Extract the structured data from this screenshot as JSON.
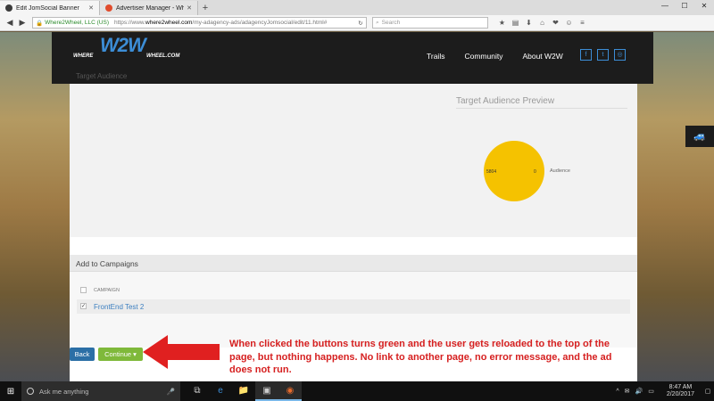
{
  "browser": {
    "tabs": [
      {
        "title": "Edit JomSocial Banner",
        "active": true,
        "favicon_color": "#3b3b3b"
      },
      {
        "title": "Advertiser Manager - Whe...",
        "active": false,
        "favicon_color": "#e04b2c"
      }
    ],
    "new_tab": "+",
    "window_controls": [
      "—",
      "☐",
      "✕"
    ],
    "nav": {
      "back": "◀",
      "forward": "▶",
      "home": "⌂"
    },
    "url": {
      "site_identity": "Where2Wheel, LLC (US)",
      "prefix": "https://www.",
      "domain": "where2wheel.com",
      "path": "/my-adagency-ads/adagencyJomsocial/edit/11.html#"
    },
    "reload": "↻",
    "search_placeholder": "Search",
    "toolbar_icons": [
      "★",
      "▤",
      "⬇",
      "⌂",
      "❤",
      "☺",
      "≡"
    ]
  },
  "site": {
    "logo": {
      "big": "W2W",
      "left_word": "WHERE",
      "right_word": "WHEEL.COM"
    },
    "nav": [
      {
        "label": "Trails"
      },
      {
        "label": "Community"
      },
      {
        "label": "About W2W"
      }
    ],
    "social_icons": [
      "f",
      "t",
      "◎"
    ],
    "target_audience_label": "Target Audience",
    "side_icon": "🚙"
  },
  "audience": {
    "title": "Target Audience Preview",
    "pie_left_value": "5804",
    "pie_right_value": "0",
    "legend": "Audience",
    "pie_color": "#f5c200"
  },
  "campaigns": {
    "header": "Add to Campaigns",
    "column": "CAMPAIGN",
    "rows": [
      {
        "label": "FrontEnd Test 2",
        "checked": true
      }
    ]
  },
  "buttons": {
    "back": "Back",
    "continue": "Continue ▾"
  },
  "annotation": "When clicked the buttons turns green and the user gets reloaded to the top of the page, but nothing happens.  No link to another page, no error message, and the ad does not run.",
  "colors": {
    "annotation": "#d62020",
    "arrow": "#e02020",
    "continue": "#7fb93a",
    "back": "#2b6fa6",
    "link": "#3c7fc0"
  },
  "taskbar": {
    "start_icon": "⊞",
    "search_placeholder": "Ask me anything",
    "mic": "🎤",
    "apps": [
      "⧉",
      "e",
      "📁",
      "▣",
      "◉"
    ],
    "tray_icons": [
      "^",
      "✉",
      "🔊",
      "▭"
    ],
    "time": "8:47 AM",
    "date": "2/20/2017",
    "notifications": "▢"
  }
}
